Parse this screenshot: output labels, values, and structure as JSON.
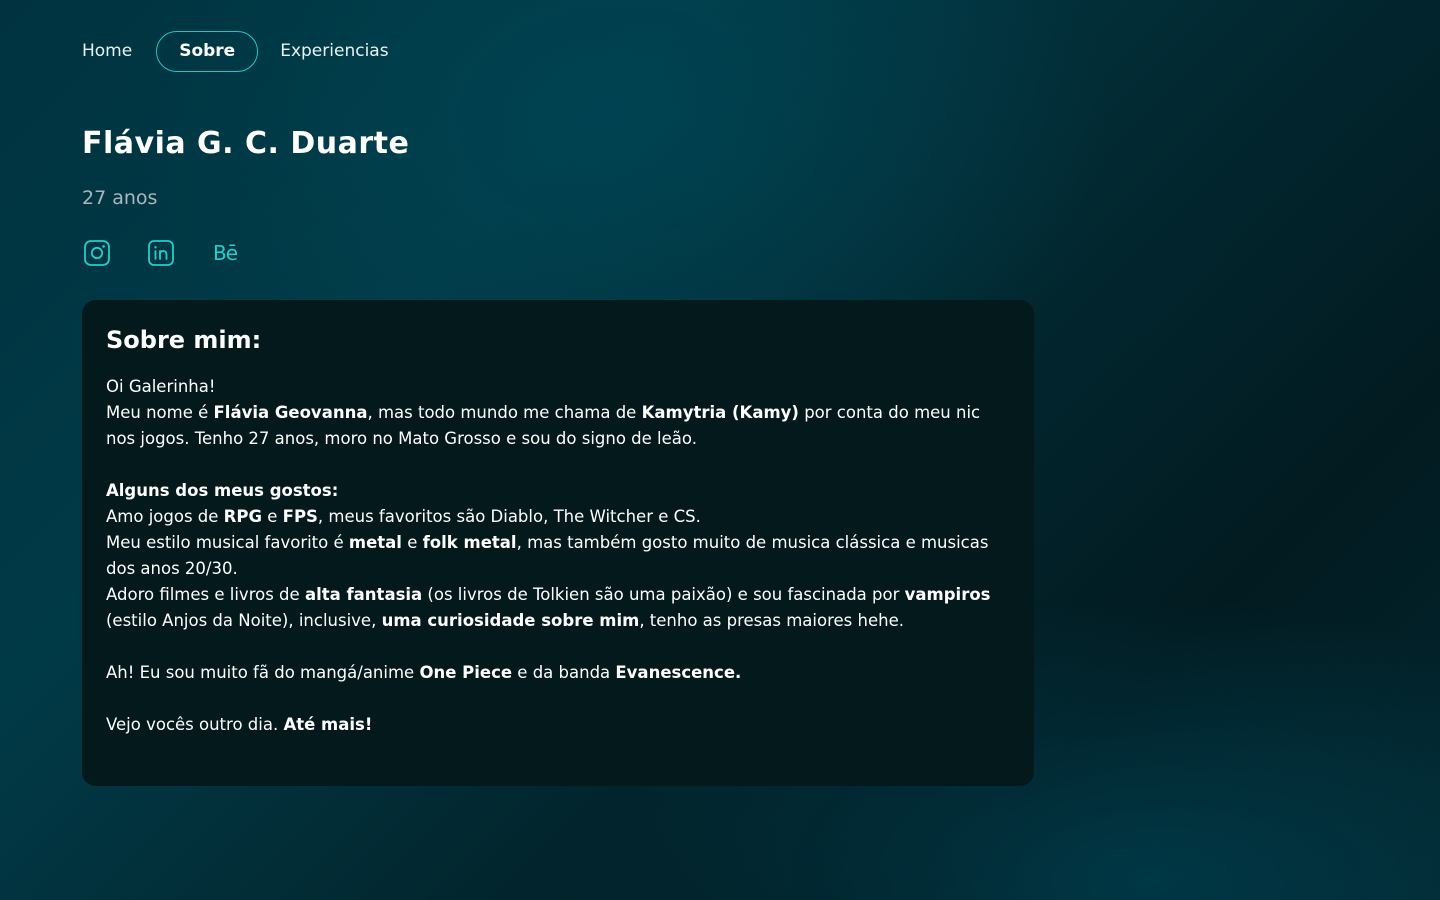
{
  "nav": {
    "home": "Home",
    "sobre": "Sobre",
    "experiencias": "Experiencias"
  },
  "profile": {
    "name": "Flávia G. C. Duarte",
    "age": "27 anos"
  },
  "socials": {
    "icons": [
      "instagram-icon",
      "linkedin-icon",
      "behance-icon"
    ],
    "behance_glyph": "Bē"
  },
  "colors": {
    "accent": "#1fc5c8",
    "card_bg": "#04191c",
    "muted_text": "#a7b9bc"
  },
  "about": {
    "title": "Sobre mim:",
    "greeting": "Oi Galerinha!",
    "intro": {
      "t1": "Meu nome é ",
      "b1": "Flávia Geovanna",
      "t2": ", mas todo mundo me chama de ",
      "b2": "Kamytria (Kamy)",
      "t3": " por conta do meu nic nos jogos. Tenho 27 anos, moro no Mato Grosso e sou do signo de leão."
    },
    "likes_heading": "Alguns dos meus gostos:",
    "games": {
      "t1": "Amo jogos de ",
      "b1": "RPG",
      "t2": " e ",
      "b2": "FPS",
      "t3": ", meus favoritos são Diablo, The Witcher e CS."
    },
    "music": {
      "t1": "Meu estilo musical favorito é ",
      "b1": "metal",
      "t2": " e ",
      "b2": "folk metal",
      "t3": ", mas também gosto muito de musica clássica e musicas dos anos 20/30."
    },
    "films": {
      "t1": "Adoro filmes e livros de ",
      "b1": "alta fantasia",
      "t2": " (os livros de Tolkien são uma paixão) e sou fascinada por ",
      "b2": "vampiros",
      "t3": " (estilo Anjos da Noite), inclusive, ",
      "b3": "uma curiosidade sobre mim",
      "t4": ", tenho as presas maiores hehe."
    },
    "fan": {
      "t1": "Ah! Eu sou muito fã do mangá/anime ",
      "b1": "One Piece",
      "t2": " e da banda ",
      "b2": "Evanescence."
    },
    "bye": {
      "t1": "Vejo vocês outro dia. ",
      "b1": "Até mais!"
    }
  }
}
